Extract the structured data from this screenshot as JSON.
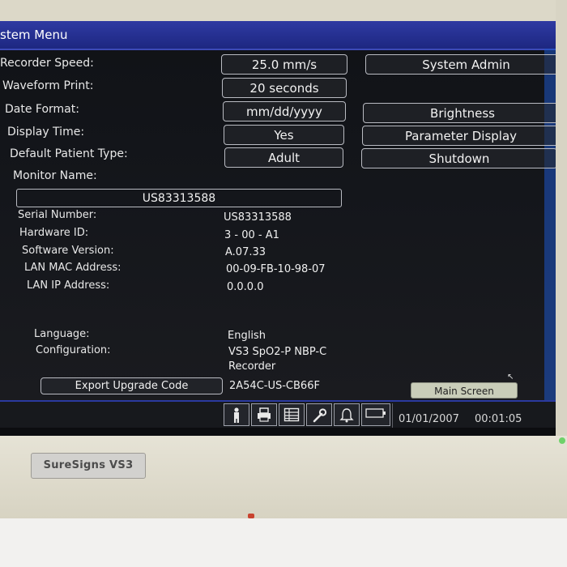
{
  "window": {
    "title": "stem Menu"
  },
  "settings": [
    {
      "label": "Recorder Speed:",
      "value": "25.0 mm/s"
    },
    {
      "label": "Waveform Print:",
      "value": "20 seconds"
    },
    {
      "label": "Date Format:",
      "value": "mm/dd/yyyy"
    },
    {
      "label": "Display Time:",
      "value": "Yes"
    },
    {
      "label": "Default Patient Type:",
      "value": "Adult"
    }
  ],
  "right_buttons": {
    "system_admin": "System Admin",
    "brightness": "Brightness",
    "parameter_display": "Parameter Display",
    "shutdown": "Shutdown"
  },
  "monitor": {
    "name_label": "Monitor Name:",
    "name_value": "US83313588"
  },
  "info": [
    {
      "label": "Serial Number:",
      "value": "US83313588"
    },
    {
      "label": "Hardware ID:",
      "value": "3 - 00 - A1"
    },
    {
      "label": "Software Version:",
      "value": "A.07.33"
    },
    {
      "label": "LAN MAC Address:",
      "value": "00-09-FB-10-98-07"
    },
    {
      "label": "LAN IP Address:",
      "value": "0.0.0.0"
    }
  ],
  "language": {
    "label": "Language:",
    "value": "English"
  },
  "configuration": {
    "label": "Configuration:",
    "value_line1": "VS3 SpO2-P NBP-C",
    "value_line2": "Recorder"
  },
  "export": {
    "button_label": "Export Upgrade Code",
    "code": "2A54C-US-CB66F"
  },
  "main_screen_label": "Main Screen",
  "status_bar": {
    "date": "01/01/2007",
    "time": "00:01:05",
    "icons": [
      "patient-icon",
      "printer-icon",
      "table-icon",
      "wrench-icon",
      "bell-icon",
      "battery-icon"
    ]
  },
  "device": {
    "brand": "SureSigns VS3"
  },
  "colors": {
    "title_bar": "#1d2781",
    "screen_bg": "#14161b",
    "main_screen_button": "#c9cdb9"
  }
}
